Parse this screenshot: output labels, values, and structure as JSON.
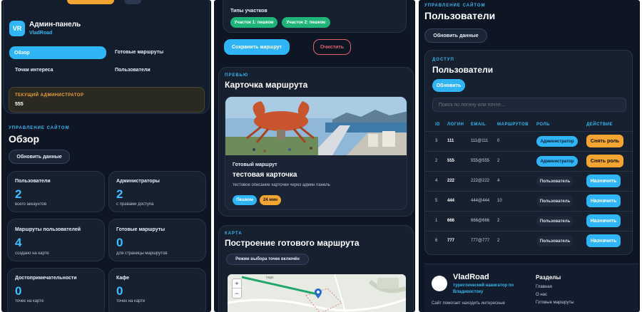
{
  "panel1": {
    "brand": {
      "avatar": "VR",
      "title": "Админ-панель",
      "subtitle": "VladRoad"
    },
    "tabs": [
      "Обзор",
      "Готовые маршруты",
      "Точки интереса",
      "Пользователи"
    ],
    "current_admin": {
      "label": "ТЕКУЩИЙ АДМИНИСТРАТОР",
      "value": "555"
    },
    "section": {
      "kicker": "УПРАВЛЕНИЕ САЙТОМ",
      "title": "Обзор",
      "refresh_label": "Обновить данные"
    },
    "stats": [
      {
        "label": "Пользователи",
        "value": "2",
        "sub": "всего аккаунтов"
      },
      {
        "label": "Администраторы",
        "value": "2",
        "sub": "с правами доступа"
      },
      {
        "label": "Маршруты пользователей",
        "value": "4",
        "sub": "создано на карте"
      },
      {
        "label": "Готовые маршруты",
        "value": "0",
        "sub": "для страницы маршрутов"
      },
      {
        "label": "Достопримечательности",
        "value": "0",
        "sub": "точек на карте"
      },
      {
        "label": "Кафе",
        "value": "0",
        "sub": "точек на карте"
      }
    ]
  },
  "panel2": {
    "participants_label": "Типы участков",
    "participant_chips": [
      "Участок 1: пешком",
      "Участок 2: пешком"
    ],
    "save_label": "Сохранить маршрут",
    "clear_label": "Очистить",
    "preview": {
      "kicker": "ПРЕВЬЮ",
      "title": "Карточка маршрута",
      "card_category": "Готовый маршрут",
      "card_title": "тестовая карточка",
      "card_desc": "тестовое описание карточки через админ панель",
      "tag_mode": "Пешком",
      "tag_time": "24 мин"
    },
    "map_section": {
      "kicker": "КАРТА",
      "title": "Построение готового маршрута",
      "mode_label": "Режим выбора точек включён",
      "zoom_in": "+",
      "zoom_out": "−",
      "map_label": "парк"
    }
  },
  "panel3": {
    "section": {
      "kicker": "УПРАВЛЕНИЕ САЙТОМ",
      "title": "Пользователи",
      "refresh_label": "Обновить данные"
    },
    "access": {
      "kicker": "ДОСТУП",
      "title": "Пользователи",
      "refresh_label": "Обновить",
      "search_placeholder": "Поиск по логину или почте..."
    },
    "columns": [
      "ID",
      "ЛОГИН",
      "EMAIL",
      "МАРШРУТОВ",
      "РОЛЬ",
      "ДЕЙСТВИЕ"
    ],
    "rows": [
      {
        "id": "3",
        "login": "111",
        "email": "111@111",
        "routes": "0",
        "role": "Администратор",
        "action": "Снять роль"
      },
      {
        "id": "2",
        "login": "555",
        "email": "555@555",
        "routes": "2",
        "role": "Администратор",
        "action": "Снять роль"
      },
      {
        "id": "4",
        "login": "222",
        "email": "222@222",
        "routes": "4",
        "role": "Пользователь",
        "action": "Назначить"
      },
      {
        "id": "5",
        "login": "444",
        "email": "444@444",
        "routes": "10",
        "role": "Пользователь",
        "action": "Назначить"
      },
      {
        "id": "1",
        "login": "666",
        "email": "666@666",
        "routes": "2",
        "role": "Пользователь",
        "action": "Назначить"
      },
      {
        "id": "6",
        "login": "777",
        "email": "777@777",
        "routes": "2",
        "role": "Пользователь",
        "action": "Назначить"
      }
    ],
    "footer": {
      "brand": "VladRoad",
      "tagline": "туристический навигатор по Владивостоку",
      "desc": "Сайт помогает находить интересные",
      "sections_title": "Разделы",
      "links": [
        "Главная",
        "О нас",
        "Готовые маршруты"
      ]
    }
  },
  "colors": {
    "accent": "#2fb4f5",
    "warning": "#f2a531",
    "danger": "#e0606a",
    "success": "#1fb57a",
    "background": "#0e1624"
  }
}
